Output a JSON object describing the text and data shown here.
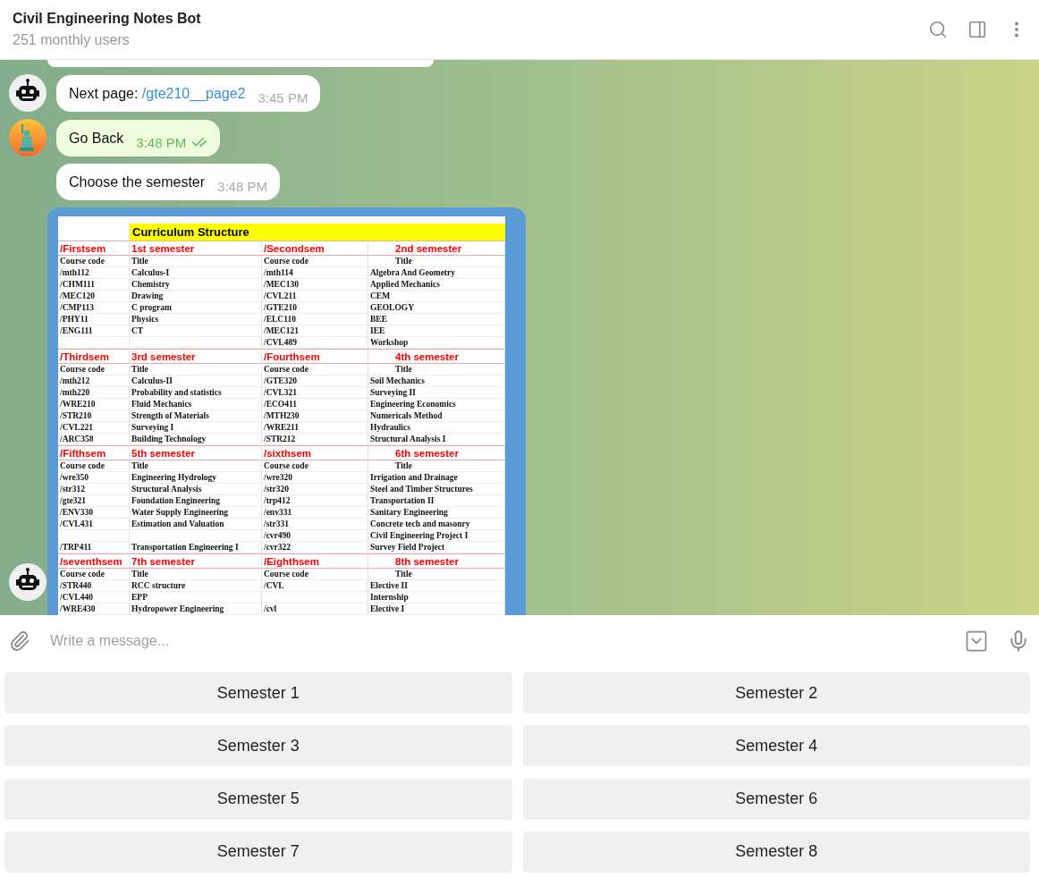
{
  "chat": {
    "title": "Civil Engineering Notes Bot",
    "subtitle": "251 monthly users"
  },
  "messages": [
    {
      "kind": "partial",
      "outgoing": false
    },
    {
      "kind": "text",
      "outgoing": false,
      "avatar": true,
      "text": "Next page:",
      "link": "/gte210__page2",
      "time": "3:45 PM"
    },
    {
      "kind": "text",
      "outgoing": true,
      "avatar": true,
      "text": "Go Back",
      "time": "3:48 PM",
      "read": true
    },
    {
      "kind": "text",
      "outgoing": false,
      "avatar": false,
      "text": "Choose the semester",
      "time": "3:48 PM"
    },
    {
      "kind": "sheet",
      "outgoing": false,
      "avatar": true,
      "sheet": {
        "title": "Curriculum Structure",
        "blocks": [
          {
            "left_command": "/Firstsem",
            "left_label": "1st semester",
            "right_command": "/Secondsem",
            "right_label": "2nd semester",
            "headers": [
              "Course code",
              "Title",
              "Course code",
              "Title"
            ],
            "rows": [
              {
                "c1": "/mth112",
                "c2": "Calculus-I",
                "c3": "/mth114",
                "c4": "Algebra And Geometry"
              },
              {
                "c1": "/CHM111",
                "c2": "Chemistry",
                "c3": "/MEC130",
                "c4": "Applied Mechanics"
              },
              {
                "c1": "/MEC120",
                "c2": "Drawing",
                "c3": "/CVL211",
                "c4": "CEM"
              },
              {
                "c1": "/CMP113",
                "c2": "C program",
                "c3": "/GTE210",
                "c4": "GEOLOGY"
              },
              {
                "c1": "/PHY11",
                "c2": "Physics",
                "c3": "/ELC110",
                "c4": "BEE"
              },
              {
                "c1": "/ENG111",
                "c2": "CT",
                "c3": "/MEC121",
                "c4": "IEE"
              },
              {
                "c3": "/CVL489",
                "c4": "Workshop"
              }
            ]
          },
          {
            "left_command": "/Thirdsem",
            "left_label": "3rd semester",
            "right_command": "/Fourthsem",
            "right_label": "4th semester",
            "headers": [
              "Course code",
              "Title",
              "Course code",
              "Title"
            ],
            "rows": [
              {
                "c1": "/mth212",
                "c2": "Calculus-II",
                "c3": "/GTE320",
                "c4": "Soil Mechanics"
              },
              {
                "c1": "/mth220",
                "c2": "Probability and statistics",
                "c3": "/CVL321",
                "c4": "Surveying II"
              },
              {
                "c1": "/WRE210",
                "c2": "Fluid Mechanics",
                "c3": "/ECO411",
                "c4": "Engineering Economics"
              },
              {
                "c1": "/STR210",
                "c2": "Strength of Materials",
                "c3": "/MTH230",
                "c4": "Numericals Method"
              },
              {
                "c1": "/CVL221",
                "c2": "Surveying I",
                "c3": "/WRE211",
                "c4": "Hydraulics"
              },
              {
                "c1": "/ARC358",
                "c2": "Building Technology",
                "c3": "/STR212",
                "c4": "Structural Analysis I"
              }
            ]
          },
          {
            "left_command": "/Fifthsem",
            "left_label": "5th semester",
            "right_command": "/sixthsem",
            "right_label": "6th semester",
            "headers": [
              "Course code",
              "Title",
              "Course code",
              "Title"
            ],
            "rows": [
              {
                "c1": "/wre350",
                "c2": "Engineering Hydrology",
                "c3": "/wre320",
                "c4": "Irrigation and Drainage"
              },
              {
                "c1": "/str312",
                "c2": "Structural Analysis",
                "c3": "/str320",
                "c4": "Steel and Timber Structures"
              },
              {
                "c1": "/gte321",
                "c2": "Foundation Engineering",
                "c3": "/trp412",
                "c4": "Transportation II"
              },
              {
                "c1": "/ENV330",
                "c2": "Water Supply Engineering",
                "c3": "/env331",
                "c4": "Sanitary Engineering"
              },
              {
                "c1": "/CVL431",
                "c2": "Estimation and Valuation",
                "c3": "/str331",
                "c4": "Concrete tech and masonry"
              },
              {
                "c3": "/cvr490",
                "c4": "Civil Engineering Project I"
              },
              {
                "c1": "/TRP411",
                "c2": "Transportation Engineering I",
                "c3": "/cvr322",
                "c4": "Survey Field Project"
              }
            ]
          },
          {
            "left_command": "/seventhsem",
            "left_label": "7th semester",
            "right_command": "/Eighthsem",
            "right_label": "8th semester",
            "headers": [
              "Course code",
              "Title",
              "Course code",
              "Title"
            ],
            "rows": [
              {
                "c1": "/STR440",
                "c2": "RCC structure",
                "c3": "/CVL",
                "c4": "Elective II"
              },
              {
                "c1": "/CVL440",
                "c2": "EPP",
                "c4": "Internship"
              },
              {
                "c1": "/WRE430",
                "c2": "Hydropower Engineering",
                "c3": "/cvl",
                "c4": "Elective I"
              }
            ]
          }
        ]
      }
    }
  ],
  "composer": {
    "placeholder": "Write a message..."
  },
  "keyboard": [
    "Semester 1",
    "Semester 2",
    "Semester 3",
    "Semester 4",
    "Semester 5",
    "Semester 6",
    "Semester 7",
    "Semester 8"
  ]
}
